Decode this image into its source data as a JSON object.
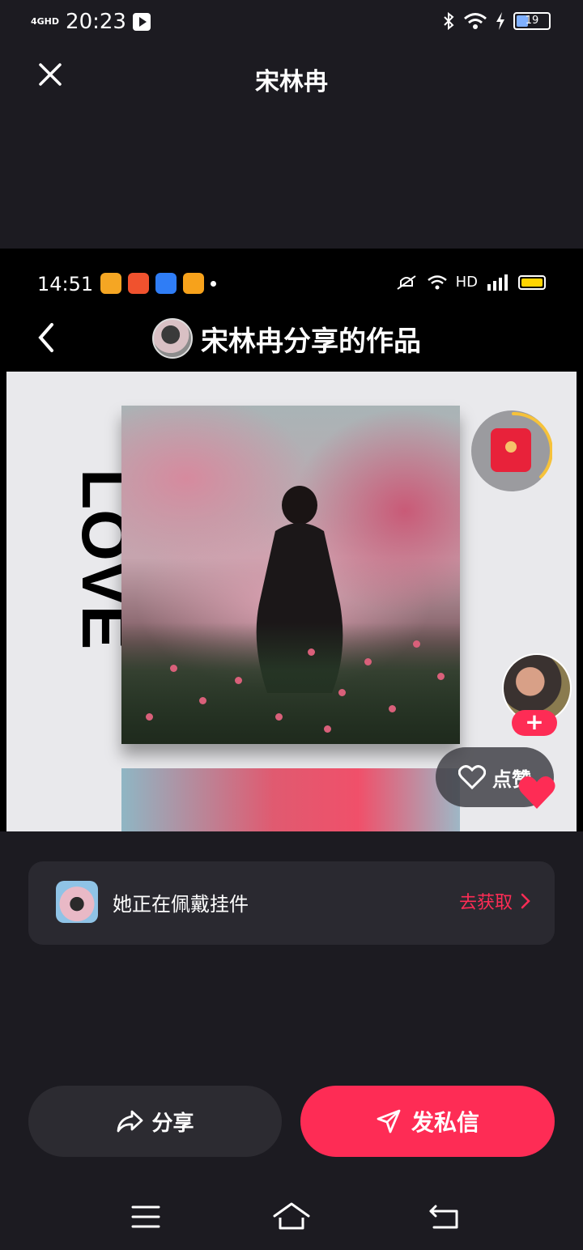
{
  "status_bar": {
    "network": "4GHD",
    "time": "20:23",
    "battery": "19",
    "icons": [
      "play-badge-icon",
      "bluetooth-icon",
      "wifi-icon",
      "charging-icon",
      "battery-icon"
    ]
  },
  "header": {
    "title": "宋林冉",
    "close_icon": "close-icon"
  },
  "screenshot": {
    "status_time": "14:51",
    "status_right_text": "HD",
    "nav_title": "宋林冉分享的作品",
    "poster_text": "LOVE",
    "like_label": "点赞",
    "follow_plus": "+"
  },
  "pendant_banner": {
    "text": "她正在佩戴挂件",
    "action": "去获取"
  },
  "actions": {
    "share_label": "分享",
    "dm_label": "发私信"
  },
  "colors": {
    "accent": "#fe2c55",
    "background": "#1c1b21"
  }
}
